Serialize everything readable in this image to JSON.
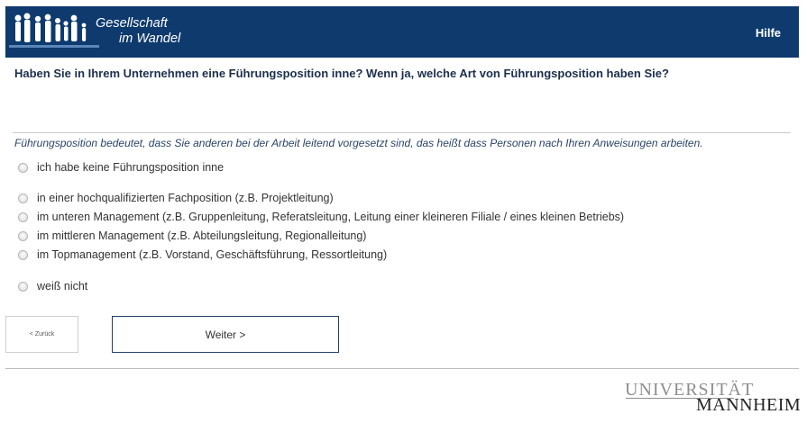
{
  "header": {
    "logo_line1": "Gesellschaft",
    "logo_line2": "im Wandel",
    "help_label": "Hilfe",
    "bg_color": "#0e3a6e"
  },
  "question": {
    "text": "Haben Sie in Ihrem Unternehmen eine Führungsposition inne? Wenn ja, welche Art von Führungsposition haben Sie?",
    "hint": "Führungsposition bedeutet, dass Sie anderen bei der Arbeit leitend vorgesetzt sind, das heißt dass Personen nach Ihren Anweisungen arbeiten.",
    "options": [
      {
        "label": "ich habe keine Führungsposition inne"
      },
      {
        "label": "in einer hochqualifizierten Fachposition (z.B. Projektleitung)"
      },
      {
        "label": "im unteren Management (z.B. Gruppenleitung, Referatsleitung, Leitung einer kleineren Filiale / eines kleinen Betriebs)"
      },
      {
        "label": "im mittleren Management (z.B. Abteilungsleitung, Regionalleitung)"
      },
      {
        "label": "im Topmanagement (z.B. Vorstand, Geschäftsführung, Ressortleitung)"
      },
      {
        "label": "weiß nicht"
      }
    ]
  },
  "nav": {
    "back_label": "< Zurück",
    "next_label": "Weiter >"
  },
  "footer": {
    "uni_line1": "UNIVERSITÄT",
    "uni_line2": "MANNHEIM"
  }
}
